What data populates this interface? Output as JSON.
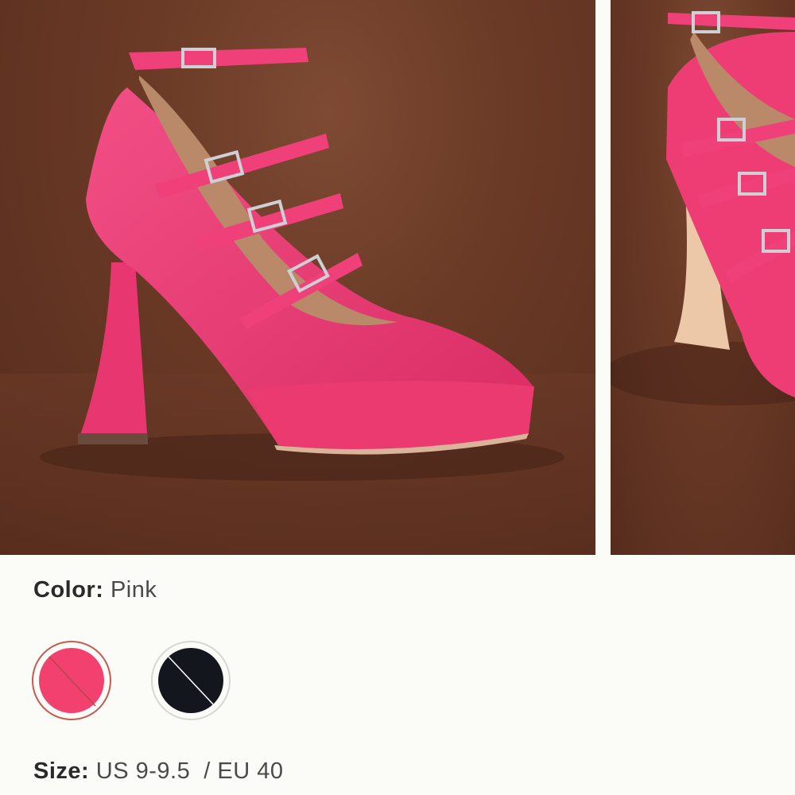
{
  "gallery": {
    "images": [
      {
        "alt": "Pink pointed-toe platform heel with buckle straps"
      },
      {
        "alt": "Pink platform heel side view"
      }
    ]
  },
  "color": {
    "label": "Color:",
    "value": "Pink",
    "swatches": [
      {
        "name": "Pink",
        "hex": "#f3416f",
        "selected": true,
        "unavailable": true
      },
      {
        "name": "Black",
        "hex": "#14161e",
        "selected": false,
        "unavailable": true
      }
    ]
  },
  "size": {
    "label": "Size:",
    "value": "US 9-9.5  / EU 40"
  },
  "colors": {
    "background": "#fbfbf8",
    "photo_bg": "#6a3a26",
    "shoe": "#ee3d74",
    "selected_ring": "#c55a4f"
  }
}
